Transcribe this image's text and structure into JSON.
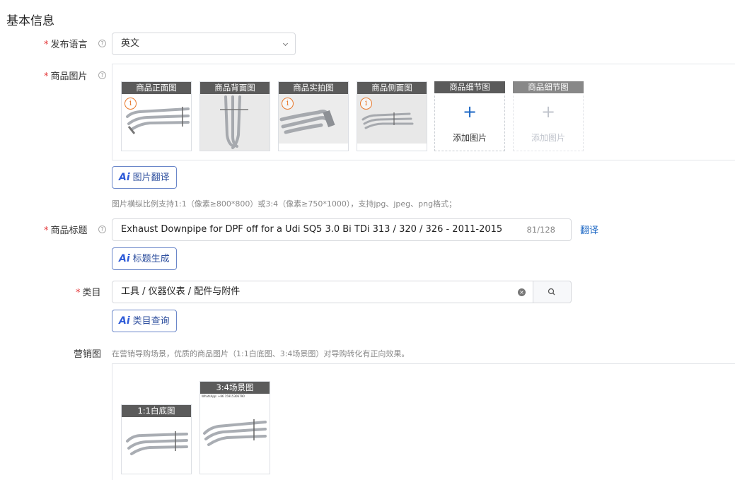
{
  "section": {
    "title": "基本信息"
  },
  "language": {
    "label": "发布语言",
    "value": "英文"
  },
  "images": {
    "label": "商品图片",
    "slots": [
      {
        "caption": "商品正面图",
        "warning": "i"
      },
      {
        "caption": "商品背面图"
      },
      {
        "caption": "商品实拍图",
        "warning": "i"
      },
      {
        "caption": "商品侧面图",
        "warning": "i"
      }
    ],
    "add_slots": [
      {
        "caption": "商品细节图",
        "plus": "+",
        "add_label": "添加图片"
      },
      {
        "caption": "商品细节图",
        "plus": "+",
        "add_label": "添加图片"
      }
    ],
    "translate_ai": "Ai",
    "translate_label": "图片翻译",
    "hint": "图片横纵比例支持1:1（像素≥800*800）或3:4（像素≥750*1000），支持jpg、jpeg、png格式；"
  },
  "title_field": {
    "label": "商品标题",
    "value": "Exhaust Downpipe for DPF off for a Udi SQ5 3.0 Bi TDi 313 / 320 / 326 - 2011-2015",
    "counter": "81/128",
    "translate_link": "翻译",
    "gen_ai": "Ai",
    "gen_label": "标题生成"
  },
  "category": {
    "label": "类目",
    "value": "工具 / 仪器仪表 / 配件与附件",
    "clear": "×",
    "query_ai": "Ai",
    "query_label": "类目查询"
  },
  "marketing": {
    "label": "营销图",
    "hint": "在营销导购场景，优质的商品图片（1:1白底图、3:4场景图）对导购转化有正向效果。",
    "cards": [
      {
        "caption": "1:1白底图"
      },
      {
        "caption": "3:4场景图",
        "watermark": "WhatsApp: +86 15915306790"
      }
    ]
  },
  "common": {
    "required": "*",
    "help": "?"
  }
}
